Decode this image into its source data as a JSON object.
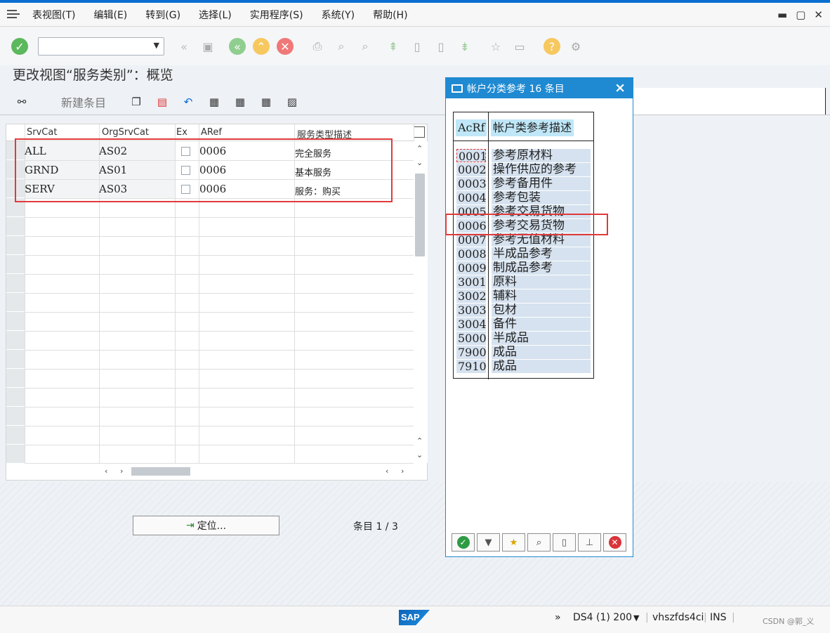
{
  "menu": {
    "items": [
      "表视图(T)",
      "编辑(E)",
      "转到(G)",
      "选择(L)",
      "实用程序(S)",
      "系统(Y)",
      "帮助(H)"
    ]
  },
  "window_controls": {
    "minimize": "▬",
    "maximize": "▢",
    "close": "✕"
  },
  "page": {
    "title": "更改视图“服务类别”：概览",
    "new_entries_label": "新建条目"
  },
  "grid": {
    "headers": [
      "SrvCat",
      "OrgSrvCat",
      "Ex",
      "ARef",
      "服务类型描述"
    ],
    "rows": [
      {
        "srvcat": "ALL",
        "orgsrvcat": "AS02",
        "aref": "0006",
        "desc": "完全服务"
      },
      {
        "srvcat": "GRND",
        "orgsrvcat": "AS01",
        "aref": "0006",
        "desc": "基本服务"
      },
      {
        "srvcat": "SERV",
        "orgsrvcat": "AS03",
        "aref": "0006",
        "desc": "服务：购买"
      }
    ]
  },
  "locate_button": "定位...",
  "entry_counter": "条目 1 / 3",
  "dialog": {
    "title": "帐户分类参考 16 条目",
    "col_key": "AcRf",
    "col_desc": "帐户类参考描述",
    "rows": [
      {
        "k": "0001",
        "v": "参考原材料"
      },
      {
        "k": "0002",
        "v": "操作供应的参考"
      },
      {
        "k": "0003",
        "v": "参考备用件"
      },
      {
        "k": "0004",
        "v": "参考包装"
      },
      {
        "k": "0005",
        "v": "参考交易货物"
      },
      {
        "k": "0006",
        "v": "参考交易货物"
      },
      {
        "k": "0007",
        "v": "参考无值材料"
      },
      {
        "k": "0008",
        "v": "半成品参考"
      },
      {
        "k": "0009",
        "v": "制成品参考"
      },
      {
        "k": "3001",
        "v": "原料"
      },
      {
        "k": "3002",
        "v": "辅料"
      },
      {
        "k": "3003",
        "v": "包材"
      },
      {
        "k": "3004",
        "v": "备件"
      },
      {
        "k": "5000",
        "v": "半成品"
      },
      {
        "k": "7900",
        "v": "成品"
      },
      {
        "k": "7910",
        "v": "成品"
      }
    ]
  },
  "status": {
    "sap_logo": "SAP",
    "system": "DS4 (1) 200",
    "server": "vhszfds4ci",
    "mode": "INS",
    "expand": "»",
    "watermark": "CSDN @郭_义"
  },
  "colors": {
    "accent": "#1f8ad2",
    "highlight": "#e03a3a",
    "brand": "#0a6ed1"
  }
}
